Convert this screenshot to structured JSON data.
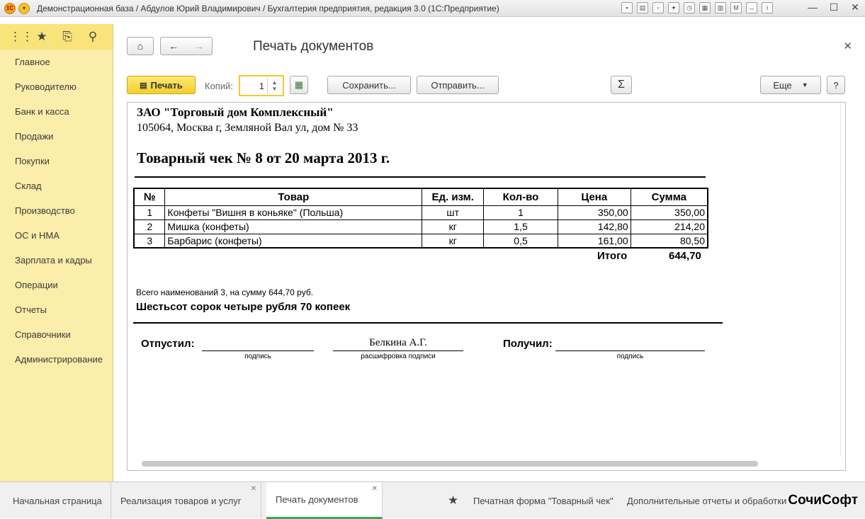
{
  "titlebar": {
    "logo": "1С",
    "title": "Демонстрационная база / Абдулов Юрий Владимирович / Бухгалтерия предприятия, редакция 3.0  (1С:Предприятие)"
  },
  "sidebar": {
    "top_icons": [
      "apps-grid-icon",
      "star-icon",
      "history-icon",
      "search-icon"
    ],
    "items": [
      {
        "label": "Главное"
      },
      {
        "label": "Руководителю"
      },
      {
        "label": "Банк и касса"
      },
      {
        "label": "Продажи"
      },
      {
        "label": "Покупки"
      },
      {
        "label": "Склад"
      },
      {
        "label": "Производство"
      },
      {
        "label": "ОС и НМА"
      },
      {
        "label": "Зарплата и кадры"
      },
      {
        "label": "Операции"
      },
      {
        "label": "Отчеты"
      },
      {
        "label": "Справочники"
      },
      {
        "label": "Администрирование"
      }
    ]
  },
  "form": {
    "title": "Печать документов",
    "print_label": "Печать",
    "copies_label": "Копий:",
    "copies_value": "1",
    "save_label": "Сохранить...",
    "send_label": "Отправить...",
    "sum_symbol": "Σ",
    "more_label": "Еще",
    "help_label": "?"
  },
  "document": {
    "org_name": "ЗАО \"Торговый дом Комплексный\"",
    "address": "105064, Москва г, Земляной Вал ул, дом № 33",
    "title": "Товарный чек № 8 от 20 марта 2013 г.",
    "columns": [
      "№",
      "Товар",
      "Ед. изм.",
      "Кол-во",
      "Цена",
      "Сумма"
    ],
    "rows": [
      [
        "1",
        "Конфеты \"Вишня в коньяке\"  (Польша)",
        "шт",
        "1",
        "350,00",
        "350,00"
      ],
      [
        "2",
        "Мишка (конфеты)",
        "кг",
        "1,5",
        "142,80",
        "214,20"
      ],
      [
        "3",
        "Барбарис (конфеты)",
        "кг",
        "0,5",
        "161,00",
        "80,50"
      ]
    ],
    "total_label": "Итого",
    "total_value": "644,70",
    "summary": "Всего наименований 3, на сумму 644,70 руб.",
    "amount_words": "Шестьсот сорок четыре рубля 70 копеек",
    "released_label": "Отпустил:",
    "signature_caption": "подпись",
    "released_name": "Белкина А.Г.",
    "decoding_caption": "расшифровка подписи",
    "received_label": "Получил:",
    "received_caption": "подпись"
  },
  "tabs": [
    {
      "label": "Начальная страница"
    },
    {
      "label": "Реализация товаров и услуг"
    },
    {
      "label": "Печать документов"
    }
  ],
  "favorites": {
    "item1": "Печатная форма \"Товарный чек\"",
    "item2": "Дополнительные отчеты и обработки"
  },
  "watermark": "СочиСофт"
}
